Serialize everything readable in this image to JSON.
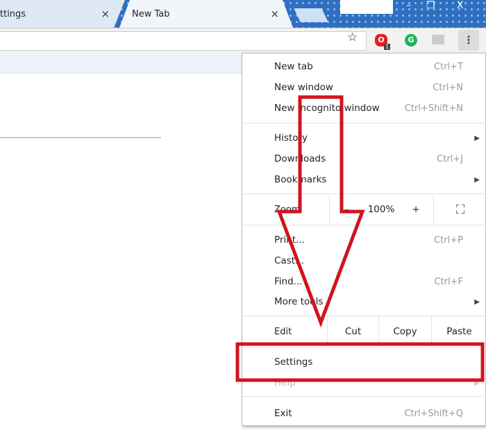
{
  "tabs": [
    {
      "label": "ttings"
    },
    {
      "label": "New Tab"
    }
  ],
  "tab_close": "×",
  "window_controls": {
    "minimize": "–",
    "restore": "❐",
    "close": "X"
  },
  "toolbar": {
    "star": "☆",
    "ext1": "O",
    "ext1_badge": "1",
    "ext2": "G",
    "menu": "⋮"
  },
  "menu": {
    "new_tab": {
      "label": "New tab",
      "shortcut": "Ctrl+T"
    },
    "new_window": {
      "label": "New window",
      "shortcut": "Ctrl+N"
    },
    "incognito": {
      "label": "New incognito window",
      "shortcut": "Ctrl+Shift+N"
    },
    "history": {
      "label": "History"
    },
    "downloads": {
      "label": "Downloads",
      "shortcut": "Ctrl+J"
    },
    "bookmarks": {
      "label": "Bookmarks"
    },
    "zoom": {
      "label": "Zoom",
      "minus": "–",
      "value": "100%",
      "plus": "+",
      "fullscreen": "⛶"
    },
    "print": {
      "label": "Print...",
      "shortcut": "Ctrl+P"
    },
    "cast": {
      "label": "Cast..."
    },
    "find": {
      "label": "Find...",
      "shortcut": "Ctrl+F"
    },
    "more_tools": {
      "label": "More tools"
    },
    "edit": {
      "label": "Edit",
      "cut": "Cut",
      "copy": "Copy",
      "paste": "Paste"
    },
    "settings": {
      "label": "Settings"
    },
    "help": {
      "label": "Help"
    },
    "exit": {
      "label": "Exit",
      "shortcut": "Ctrl+Shift+Q"
    },
    "submenu_arrow": "▶"
  },
  "colors": {
    "annotation": "#d0141e"
  }
}
